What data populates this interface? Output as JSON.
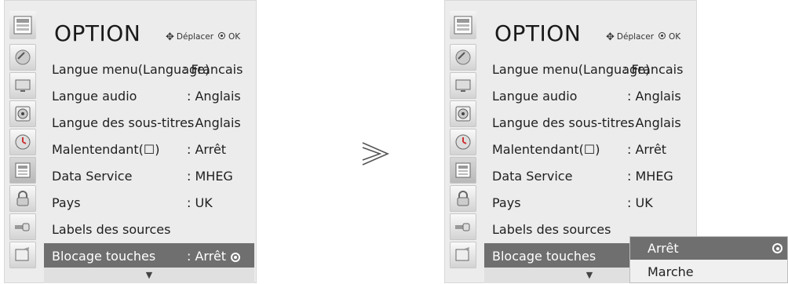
{
  "menu": {
    "title": "OPTION",
    "nav_move_label": "Déplacer",
    "nav_ok_label": "OK",
    "items": [
      {
        "label": "Langue menu(Language)",
        "value": ": Francais"
      },
      {
        "label": "Langue audio",
        "value": ": Anglais"
      },
      {
        "label": "Langue des sous-titres",
        "value": ": Anglais"
      },
      {
        "label": "Malentendant(☐)",
        "value": ": Arrêt"
      },
      {
        "label": "Data Service",
        "value": ": MHEG"
      },
      {
        "label": "Pays",
        "value": ": UK"
      },
      {
        "label": "Labels des sources",
        "value": ""
      },
      {
        "label": "Blocage touches",
        "value": ": Arrêt"
      }
    ],
    "selected_index": 7,
    "scroll_arrow": "▼",
    "sidebar_icons": [
      "satellite-icon",
      "monitor-icon",
      "speaker-icon",
      "clock-icon",
      "option-icon",
      "lock-icon",
      "input-icon",
      "screen-icon"
    ],
    "active_sidebar_index": 4
  },
  "between_arrow": "≫",
  "popup": {
    "options": [
      "Arrêt",
      "Marche"
    ],
    "selected_index": 0
  },
  "colors": {
    "panel_bg": "#ececec",
    "highlight": "#6f6f6f",
    "text": "#1f1f1f"
  }
}
